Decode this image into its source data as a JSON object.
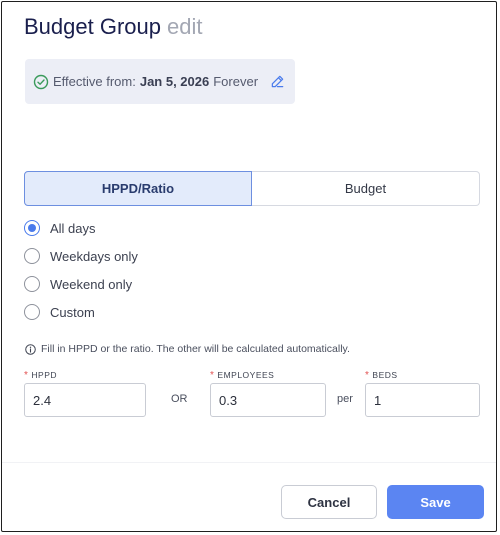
{
  "header": {
    "title": "Budget Group",
    "mode": "edit"
  },
  "effective": {
    "label": "Effective from:",
    "date": "Jan 5, 2026",
    "until": "Forever",
    "icon": "check-circle-icon",
    "edit_icon": "pencil-icon"
  },
  "tabs": [
    {
      "label": "HPPD/Ratio",
      "active": true
    },
    {
      "label": "Budget",
      "active": false
    }
  ],
  "day_options": [
    {
      "label": "All days",
      "checked": true
    },
    {
      "label": "Weekdays only",
      "checked": false
    },
    {
      "label": "Weekend only",
      "checked": false
    },
    {
      "label": "Custom",
      "checked": false
    }
  ],
  "hint": "Fill in HPPD or the ratio. The other will be calculated automatically.",
  "fields": {
    "hppd": {
      "label": "HPPD",
      "value": "2.4"
    },
    "or_label": "OR",
    "employees": {
      "label": "EMPLOYEES",
      "value": "0.3"
    },
    "per_label": "per",
    "beds": {
      "label": "BEDS",
      "value": "1"
    }
  },
  "buttons": {
    "cancel": "Cancel",
    "save": "Save"
  },
  "colors": {
    "accent": "#5b85f2",
    "radio_checked": "#4a7bec",
    "required": "#e25252",
    "success": "#3a9a5b"
  }
}
